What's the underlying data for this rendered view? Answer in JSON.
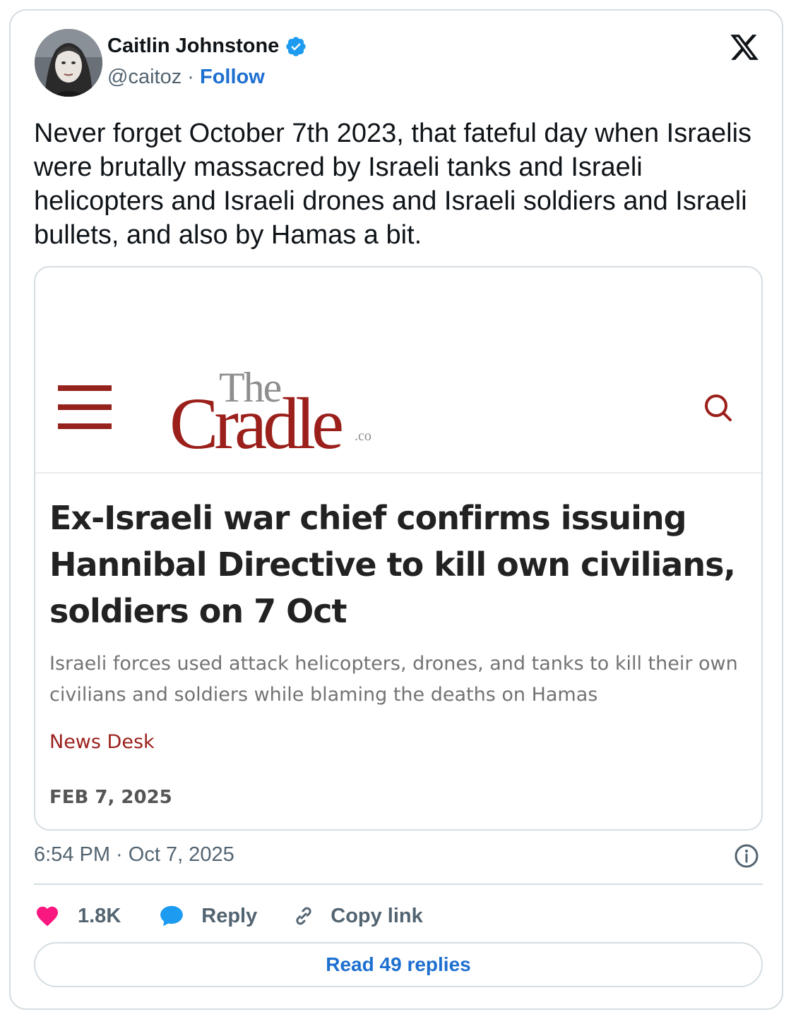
{
  "author": {
    "name": "Caitlin Johnstone",
    "handle": "@caitoz",
    "separator": "·",
    "follow_label": "Follow",
    "verified": true
  },
  "tweet": {
    "text": "Never forget October 7th 2023, that fateful day when Israelis were brutally massacred by Israeli tanks and Israeli helicopters and Israeli drones and Israeli soldiers and Israeli bullets, and also by Hamas a bit.",
    "timestamp": "6:54 PM · Oct 7, 2025"
  },
  "embed": {
    "site_logo_the": "The",
    "site_logo_cradle": "Cradle",
    "site_logo_co": ".co",
    "headline": "Ex-Israeli war chief confirms issuing Hannibal Directive to kill own civilians, soldiers on 7 Oct",
    "subtitle": "Israeli forces used attack helicopters, drones, and tanks to kill their own civilians and soldiers while blaming the deaths on Hamas",
    "byline": "News Desk",
    "date": "FEB 7, 2025"
  },
  "actions": {
    "likes": "1.8K",
    "reply_label": "Reply",
    "copy_link_label": "Copy link"
  },
  "read_replies_label": "Read 49 replies",
  "colors": {
    "brand_blue": "#1d6fd0",
    "like_pink": "#f91880",
    "reply_blue": "#1d9bf0",
    "cradle_red": "#9b1f1a"
  }
}
